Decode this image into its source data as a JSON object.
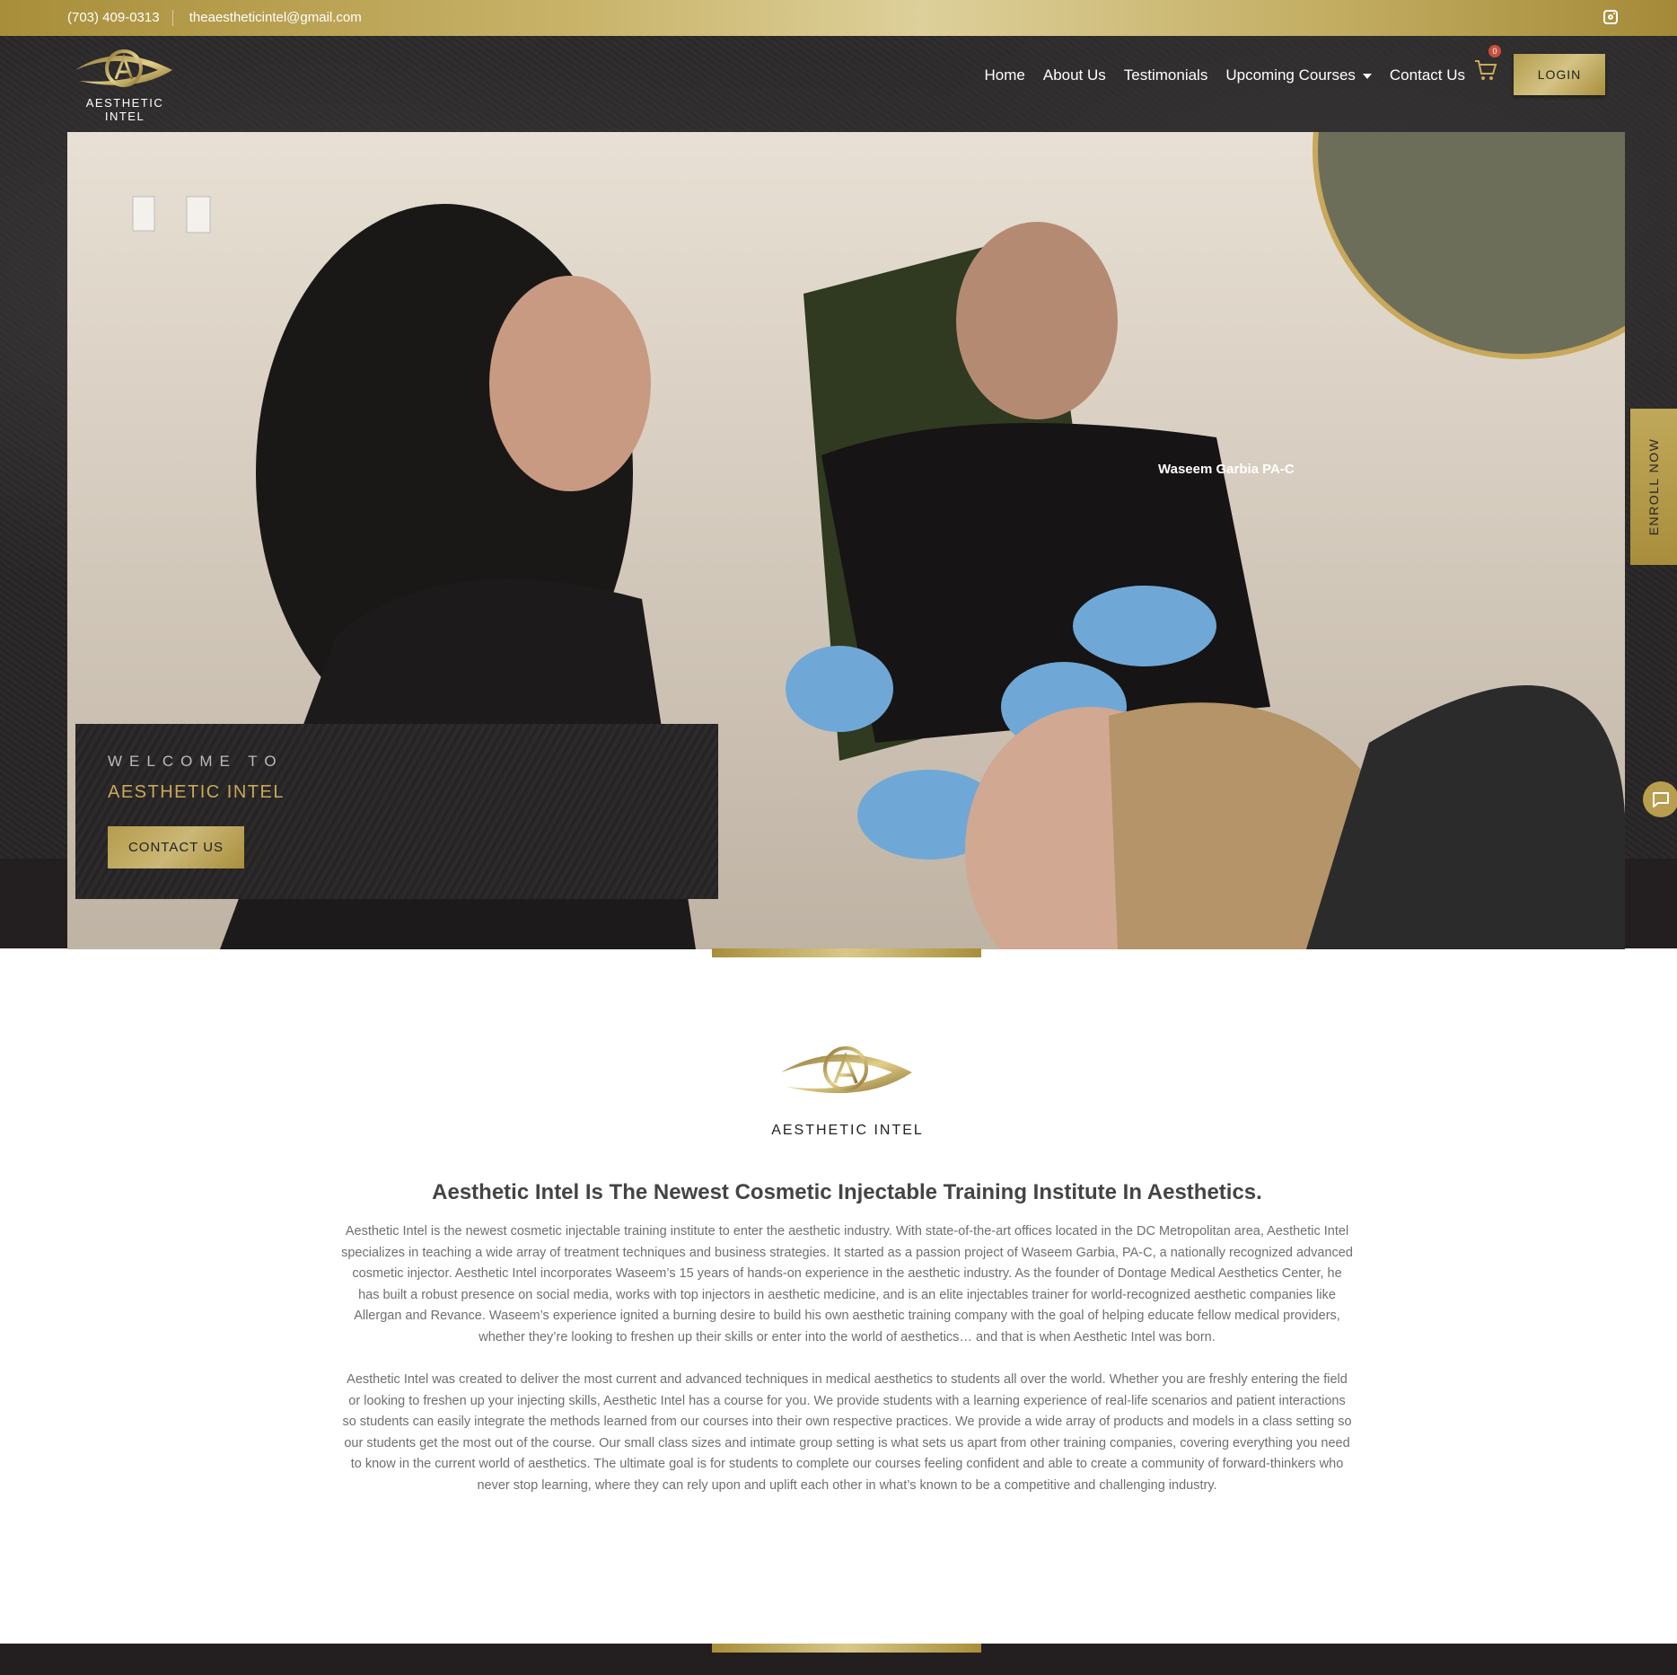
{
  "topbar": {
    "phone": "(703) 409-0313",
    "email": "theaestheticintel@gmail.com",
    "social_icon": "instagram-icon"
  },
  "header": {
    "logo_text": "AESTHETIC INTEL",
    "nav": [
      {
        "label": "Home"
      },
      {
        "label": "About Us"
      },
      {
        "label": "Testimonials"
      },
      {
        "label": "Upcoming Courses"
      },
      {
        "label": "Contact Us"
      }
    ],
    "cart_count": "0",
    "login_label": "LOGIN"
  },
  "hero": {
    "welcome": "WELCOME TO",
    "title": "AESTHETIC INTEL",
    "cta_label": "CONTACT US",
    "photo_name_tag": "Waseem Garbia PA-C"
  },
  "side": {
    "enroll_label": "ENROLL NOW",
    "chat_icon": "chat-icon"
  },
  "about": {
    "logo_text": "AESTHETIC INTEL",
    "heading": "Aesthetic Intel Is The Newest Cosmetic Injectable Training Institute In Aesthetics.",
    "paragraph1": "Aesthetic Intel is the newest cosmetic injectable training institute to enter the aesthetic industry. With state-of-the-art offices located in the DC Metropolitan area, Aesthetic Intel specializes in teaching a wide array of treatment techniques and business strategies. It started as a passion project of Waseem Garbia, PA-C, a nationally recognized advanced cosmetic injector. Aesthetic Intel incorporates Waseem’s 15 years of hands-on experience in the aesthetic industry. As the founder of Dontage Medical Aesthetics Center, he has built a robust presence on social media, works with top injectors in aesthetic medicine, and is an elite injectables trainer for world-recognized aesthetic companies like Allergan and Revance. Waseem’s experience ignited a burning desire to build his own aesthetic training company with the goal of helping educate fellow medical providers, whether they’re looking to freshen up their skills or enter into the world of aesthetics… and that is when Aesthetic Intel was born.",
    "paragraph2": "Aesthetic Intel was created to deliver the most current and advanced techniques in medical aesthetics to students all over the world. Whether you are freshly entering the field or looking to freshen up your injecting skills, Aesthetic Intel has a course for you. We provide students with a learning experience of real-life scenarios and patient interactions so students can easily integrate the methods learned from our courses into their own respective practices. We provide a wide array of products and models in a class setting so our students get the most out of the course. Our small class sizes and intimate group setting is what sets us apart from other training companies, covering everything you need to know in the current world of aesthetics. The ultimate goal is for students to complete our courses feeling confident and able to create a community of forward-thinkers who never stop learning, where they can rely upon and uplift each other in what’s known to be a competitive and challenging industry."
  },
  "colors": {
    "gold": "#b89e4e",
    "dark": "#231f20",
    "text": "#6f6f6f"
  }
}
